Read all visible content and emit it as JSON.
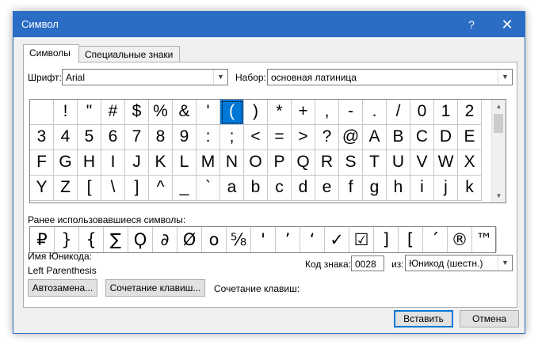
{
  "title": "Символ",
  "titlebar": {
    "help": "?",
    "close": "✕"
  },
  "tabs": [
    {
      "label": "Символы"
    },
    {
      "label": "Специальные знаки"
    }
  ],
  "font": {
    "label": "Шрифт:",
    "value": "Arial"
  },
  "subset": {
    "label": "Набор:",
    "value": "основная латиница"
  },
  "grid": {
    "selected": "(",
    "rows": [
      [
        " ",
        "!",
        "\"",
        "#",
        "$",
        "%",
        "&",
        "'",
        "(",
        ")",
        "*",
        "+",
        ",",
        "-",
        ".",
        "/",
        "0",
        "1",
        "2"
      ],
      [
        "3",
        "4",
        "5",
        "6",
        "7",
        "8",
        "9",
        ":",
        ";",
        "<",
        "=",
        ">",
        "?",
        "@",
        "A",
        "B",
        "C",
        "D",
        "E"
      ],
      [
        "F",
        "G",
        "H",
        "I",
        "J",
        "K",
        "L",
        "M",
        "N",
        "O",
        "P",
        "Q",
        "R",
        "S",
        "T",
        "U",
        "V",
        "W",
        "X"
      ],
      [
        "Y",
        "Z",
        "[",
        "\\",
        "]",
        "^",
        "_",
        "`",
        "a",
        "b",
        "c",
        "d",
        "e",
        "f",
        "g",
        "h",
        "i",
        "j",
        "k"
      ]
    ]
  },
  "recent": {
    "label": "Ранее использовавшиеся символы:",
    "items": [
      "₽",
      "}",
      "{",
      "∑",
      "Ϙ",
      "∂",
      "Ø",
      "о",
      "⅝",
      "'",
      "’",
      "‘",
      "✓",
      "☑",
      "]",
      "[",
      "´",
      "®",
      "™"
    ]
  },
  "unicode_name": {
    "label": "Имя Юникода:",
    "value": "Left Parenthesis"
  },
  "char_code": {
    "label": "Код знака:",
    "value": "0028"
  },
  "from": {
    "label": "из:",
    "value": "Юникод (шестн.)"
  },
  "buttons": {
    "autocorrect": "Автозамена...",
    "shortcut_key": "Сочетание клавиш...",
    "shortcut_label": "Сочетание клавиш:",
    "insert": "Вставить",
    "cancel": "Отмена"
  }
}
